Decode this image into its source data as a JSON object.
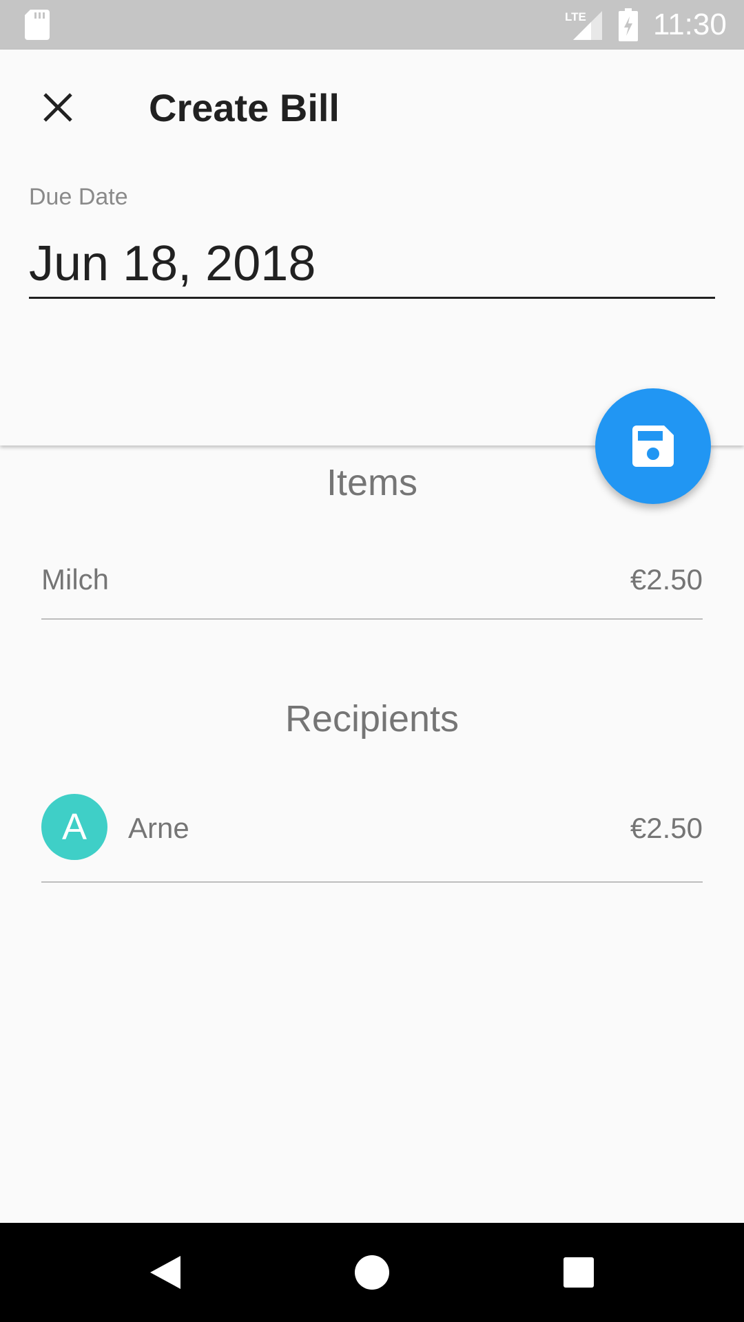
{
  "status_bar": {
    "time": "11:30",
    "network": "LTE",
    "icons": [
      "sd-card-icon",
      "lte-signal-icon",
      "battery-charging-icon"
    ]
  },
  "header": {
    "title": "Create Bill",
    "close_icon": "close-icon"
  },
  "due_date": {
    "label": "Due Date",
    "value": "Jun 18, 2018"
  },
  "fab": {
    "icon": "save-icon",
    "color": "#2196f3"
  },
  "items": {
    "title": "Items",
    "rows": [
      {
        "name": "Milch",
        "price": "€2.50"
      }
    ]
  },
  "recipients": {
    "title": "Recipients",
    "rows": [
      {
        "initial": "A",
        "name": "Arne",
        "amount": "€2.50",
        "avatar_color": "#3fcfc7"
      }
    ]
  },
  "nav_bar": {
    "icons": [
      "back-icon",
      "home-icon",
      "recents-icon"
    ]
  }
}
